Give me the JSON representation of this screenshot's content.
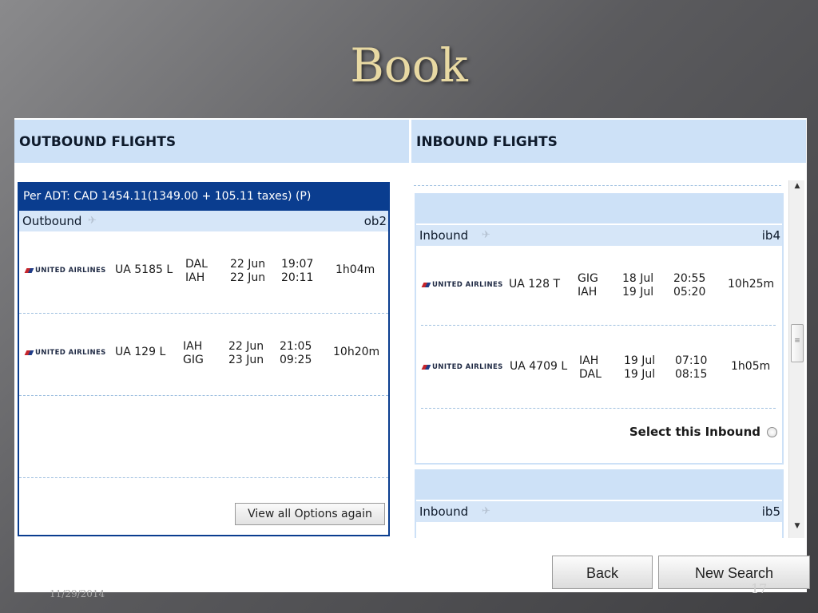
{
  "slide": {
    "title": "Book",
    "date": "11/29/2014",
    "page": "17"
  },
  "outbound": {
    "header": "OUTBOUND FLIGHTS",
    "fare": "Per ADT: CAD 1454.11(1349.00 + 105.11 taxes) (P)",
    "leg_label": "Outbound",
    "leg_code": "ob2",
    "segments": [
      {
        "airline": "UNITED AIRLINES",
        "flight": "UA 5185 L",
        "from": "DAL",
        "to": "IAH",
        "dep_date": "22 Jun",
        "arr_date": "22 Jun",
        "dep_time": "19:07",
        "arr_time": "20:11",
        "duration": "1h04m"
      },
      {
        "airline": "UNITED AIRLINES",
        "flight": "UA 129 L",
        "from": "IAH",
        "to": "GIG",
        "dep_date": "22 Jun",
        "arr_date": "23 Jun",
        "dep_time": "21:05",
        "arr_time": "09:25",
        "duration": "10h20m"
      }
    ],
    "view_all_label": "View all Options again"
  },
  "inbound": {
    "header": "INBOUND FLIGHTS",
    "options": [
      {
        "leg_label": "Inbound",
        "leg_code": "ib4",
        "segments": [
          {
            "airline": "UNITED AIRLINES",
            "flight": "UA 128 T",
            "from": "GIG",
            "to": "IAH",
            "dep_date": "18 Jul",
            "arr_date": "19 Jul",
            "dep_time": "20:55",
            "arr_time": "05:20",
            "duration": "10h25m"
          },
          {
            "airline": "UNITED AIRLINES",
            "flight": "UA 4709 L",
            "from": "IAH",
            "to": "DAL",
            "dep_date": "19 Jul",
            "arr_date": "19 Jul",
            "dep_time": "07:10",
            "arr_time": "08:15",
            "duration": "1h05m"
          }
        ],
        "select_label": "Select this Inbound"
      },
      {
        "leg_label": "Inbound",
        "leg_code": "ib5"
      }
    ]
  },
  "buttons": {
    "back": "Back",
    "new_search": "New Search"
  },
  "icons": {
    "plane": "plane-icon",
    "scroll_up": "scroll-up-arrow-icon",
    "scroll_down": "scroll-down-arrow-icon",
    "grip": "scroll-grip-icon"
  },
  "colors": {
    "header_bg": "#cde1f7",
    "fare_bar": "#0a3d8f",
    "title": "#e8d9a3"
  }
}
